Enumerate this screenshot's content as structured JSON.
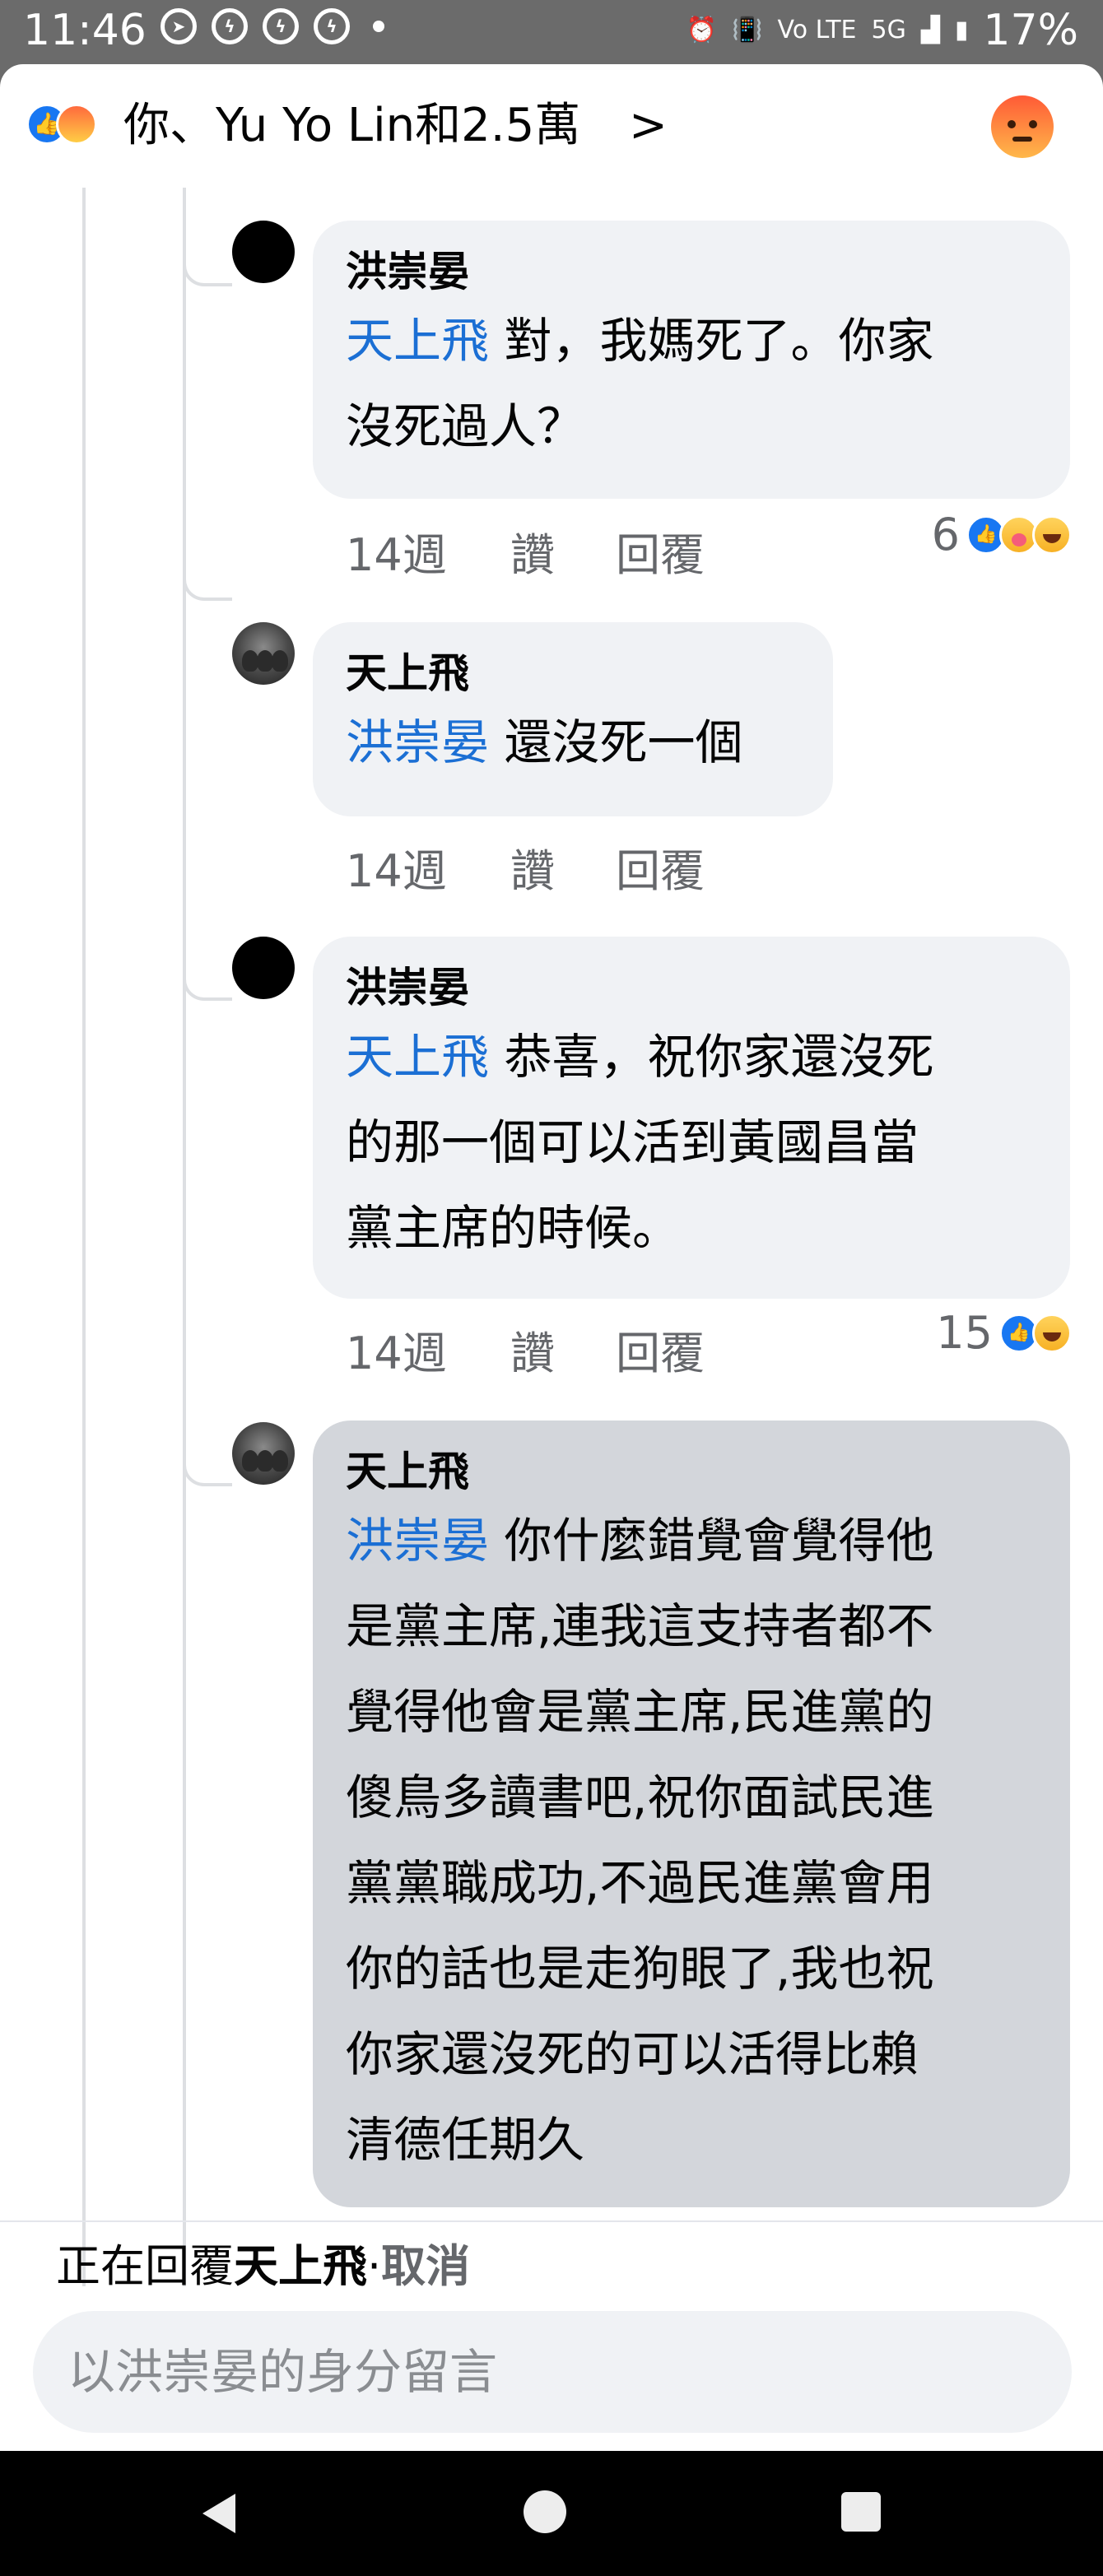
{
  "status_bar": {
    "time": "11:46",
    "battery": "17%",
    "network": "5G",
    "lte": "Vo LTE"
  },
  "header": {
    "reactions_text": "你、Yu Yo Lin和2.5萬",
    "chevron": ">"
  },
  "comments": [
    {
      "author": "洪崇晏",
      "mention": "天上飛",
      "lines": [
        "對，我媽死了。你家",
        "沒死過人？"
      ],
      "time": "14週",
      "like_label": "讚",
      "reply_label": "回覆",
      "reaction_count": "6"
    },
    {
      "author": "天上飛",
      "mention": "洪崇晏",
      "lines": [
        "還沒死一個"
      ],
      "time": "14週",
      "like_label": "讚",
      "reply_label": "回覆"
    },
    {
      "author": "洪崇晏",
      "mention": "天上飛",
      "lines": [
        "恭喜，祝你家還沒死",
        "的那一個可以活到黃國昌當",
        "黨主席的時候。"
      ],
      "time": "14週",
      "like_label": "讚",
      "reply_label": "回覆",
      "reaction_count": "15"
    },
    {
      "author": "天上飛",
      "mention": "洪崇晏",
      "lines": [
        "你什麼錯覺會覺得他",
        "是黨主席,連我這支持者都不",
        "覺得他會是黨主席,民進黨的",
        "傻鳥多讀書吧,祝你面試民進",
        "黨黨職成功,不過民進黨會用",
        "你的話也是走狗眼了,我也祝",
        "你家還沒死的可以活得比賴",
        "清德任期久"
      ]
    }
  ],
  "reply_bar": {
    "prefix": "正在回覆",
    "target": "天上飛",
    "separator": "·",
    "cancel": "取消",
    "placeholder": "以洪崇晏的身分留言"
  }
}
